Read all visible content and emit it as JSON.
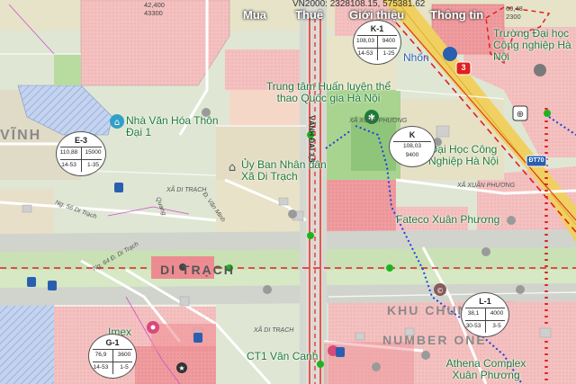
{
  "navigation": {
    "items": [
      "Mua",
      "Thuê",
      "Giới thiệu",
      "Thông tin"
    ]
  },
  "coordinates_readout": "VN2000: 2328108.15, 575381.62",
  "corner_labels": {
    "top_left": [
      "42,400",
      "43300"
    ],
    "top_right": [
      "60,48",
      "2300"
    ]
  },
  "places": {
    "university_top": "Trường Đại học Công nghiệp Hà Nội",
    "university_mid": "Đại Học Công Nghiệp Hà Nội",
    "training_center": "Trung tâm Huấn luyện thể thao Quốc gia Hà Nội",
    "cultural_house": "Nhà Văn Hóa Thôn Đại 1",
    "peoples_committee": "Ủy Ban Nhân dân Xã Di Trạch",
    "nhon": "Nhổn",
    "ward_label_1": "XÃ XUÂN PHƯƠNG",
    "ward_label_2": "XÃ XUÂN PHƯƠNG",
    "fateco": "Fateco Xuân Phương",
    "di_trach": "DI TRẠCH",
    "vinh": "VĨNH",
    "khu_chung_cu": "KHU CHUNG CƯ",
    "number_one": "NUMBER ONE",
    "imex": "Imex",
    "ct1": "CT1 Vân Canh",
    "athena": "Athena Complex Xuân Phương",
    "vanh_dai": "VÀNH ĐAI 3,5",
    "xa_di_trach_1": "XÃ DI TRẠCH",
    "xa_di_trach_2": "XÃ DI TRẠCH",
    "van_minh": "Đ. Văn Minh",
    "quang_street": "Quang",
    "ng64": "Ng. 64 Đ. Di Trạch",
    "ng56": "Ng. 56 Di Trạch",
    "road_3": "3",
    "road_dt70": "ĐT70"
  },
  "plots": [
    {
      "id": "K-1",
      "tl": "108,03",
      "tr": "9400",
      "bl": "14-53",
      "br": "1-25"
    },
    {
      "id": "E-3",
      "tl": "110,88",
      "tr": "15000",
      "bl": "14-53",
      "br": "1-35"
    },
    {
      "id": "K",
      "tl": "108,03",
      "tr": "9400",
      "bl": "",
      "br": ""
    },
    {
      "id": "L-1",
      "tl": "38,1",
      "tr": "4000",
      "bl": "30-53",
      "br": "3-5"
    },
    {
      "id": "G-1",
      "tl": "76,9",
      "tr": "3600",
      "bl": "14-53",
      "br": "1-5"
    }
  ],
  "colors": {
    "background": "#dfe6d4",
    "residential_pink": "#f3b8b6",
    "commercial_red": "#ee8f94",
    "road_yellow": "#f0d060",
    "green_area": "#9fcf86",
    "blue_hatch": "#a9bfe4",
    "red_boundary": "#e02020",
    "blue_boundary": "#1f3fe0"
  },
  "icon_names": [
    "location-pin-icon",
    "building-icon",
    "bus-stop-icon",
    "parking-icon",
    "metro-station-icon",
    "school-icon"
  ]
}
